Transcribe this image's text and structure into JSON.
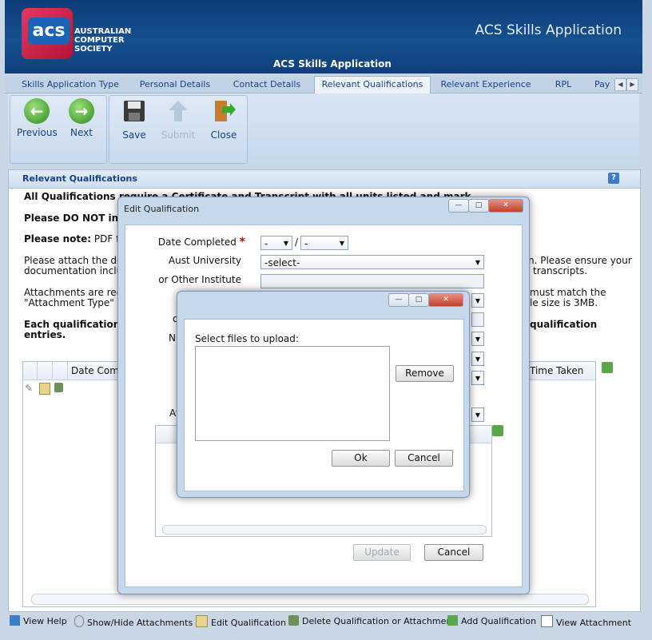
{
  "header": {
    "logo_mark": "acs",
    "logo_text_lines": [
      "AUSTRALIAN",
      "COMPUTER",
      "SOCIETY"
    ],
    "title_right": "ACS Skills Application",
    "title_center": "ACS Skills Application"
  },
  "tabs": [
    {
      "label": "Skills Application Type"
    },
    {
      "label": "Personal Details"
    },
    {
      "label": "Contact Details"
    },
    {
      "label": "Relevant Qualifications"
    },
    {
      "label": "Relevant Experience"
    },
    {
      "label": "RPL"
    },
    {
      "label": "Pay"
    }
  ],
  "toolbar": {
    "previous": "Previous",
    "next": "Next",
    "save": "Save",
    "submit": "Submit",
    "close": "Close"
  },
  "panel": {
    "title": "Relevant Qualifications",
    "line1": "All Qualifications require a Certificate and Transcript with all units listed and marks achieved",
    "line2": "Please DO NOT inclu",
    "line3_bold": "Please note:",
    "line3_rest": " PDF files",
    "line4a": "Please attach the detai",
    "line4b": "documentation includ",
    "line4c": "n. Please ensure your",
    "line4d": " transcripts.",
    "line5a": "Attachments are requi",
    "line5b": "\"Attachment Type\" na",
    "line5c": "must match the",
    "line5d": "le size is 3MB.",
    "line6a": "Each qualification s",
    "line6b": "entries.",
    "line6c": "qualification",
    "grid_col_date": "Date Comp",
    "grid_col_time": "Time Taken"
  },
  "dialog_edit": {
    "title": "Edit Qualification",
    "date_completed_label": "Date Completed",
    "date_sep": "/",
    "date_day": "-",
    "date_year": "-",
    "aust_university_label": "Aust University",
    "aust_university_value": "-select-",
    "other_institute_label": "or Other Institute",
    "partial_o": "o",
    "partial_n": "N",
    "partial_at": "At",
    "update_button": "Update",
    "cancel_button": "Cancel"
  },
  "dialog_upload": {
    "prompt": "Select files to upload:",
    "remove_button": "Remove",
    "ok_button": "Ok",
    "cancel_button": "Cancel"
  },
  "statusbar": {
    "view_help": "View Help",
    "show_hide": "Show/Hide Attachments",
    "edit": "Edit Qualification",
    "delete": "Delete Qualification or Attachment",
    "add": "Add Qualification",
    "view_attachment": "View Attachment"
  },
  "colors": {
    "header_bg": "#16508f",
    "tab_text": "#15428b",
    "required": "#cc0000"
  }
}
